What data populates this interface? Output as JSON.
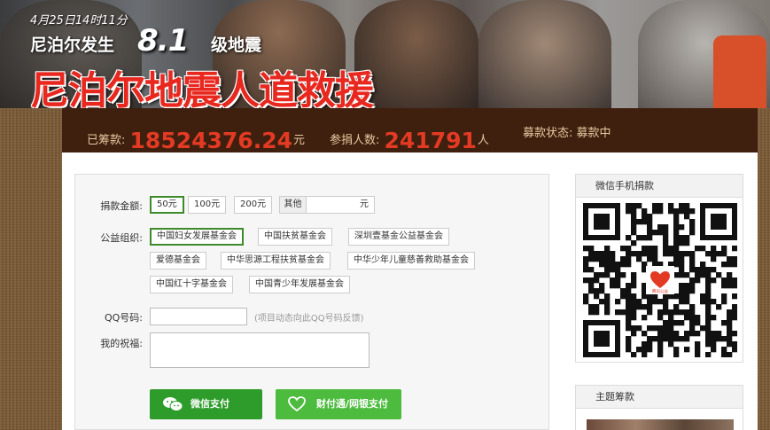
{
  "banner": {
    "date": "4月25日14时11分",
    "subtitle_prefix": "尼泊尔发生",
    "magnitude": "8.1",
    "subtitle_suffix": "级地震",
    "title": "尼泊尔地震人道救援"
  },
  "stats": {
    "raised_label": "已筹款:",
    "raised_value": "18524376.24",
    "raised_unit": "元",
    "donors_label": "参捐人数:",
    "donors_value": "241791",
    "donors_unit": "人",
    "status_label": "募款状态:",
    "status_value": "募款中"
  },
  "form": {
    "amount_label": "捐款金额:",
    "amounts": [
      "50元",
      "100元",
      "200元"
    ],
    "other_label": "其他",
    "other_unit": "元",
    "org_label": "公益组织:",
    "orgs": [
      "中国妇女发展基金会",
      "中国扶贫基金会",
      "深圳壹基金公益基金会",
      "爱德基金会",
      "中华思源工程扶贫基金会",
      "中华少年儿童慈善救助基金会",
      "中国红十字基金会",
      "中国青少年发展基金会"
    ],
    "qq_label": "QQ号码:",
    "qq_hint": "(项目动态向此QQ号码反馈)",
    "wish_label": "我的祝福:",
    "wechat_pay": "微信支付",
    "tenpay_pay": "财付通/网银支付"
  },
  "sidebar": {
    "wechat_title": "微信手机捐款",
    "qr_logo_text": "腾讯公益",
    "topic_title": "主题筹款"
  },
  "colors": {
    "stat_bar": "#3f1f0e",
    "number_red": "#e33a24",
    "pay_green": "#2e9c2a",
    "pay_green_light": "#4cbb3e",
    "selected_border": "#3d8a2a"
  }
}
